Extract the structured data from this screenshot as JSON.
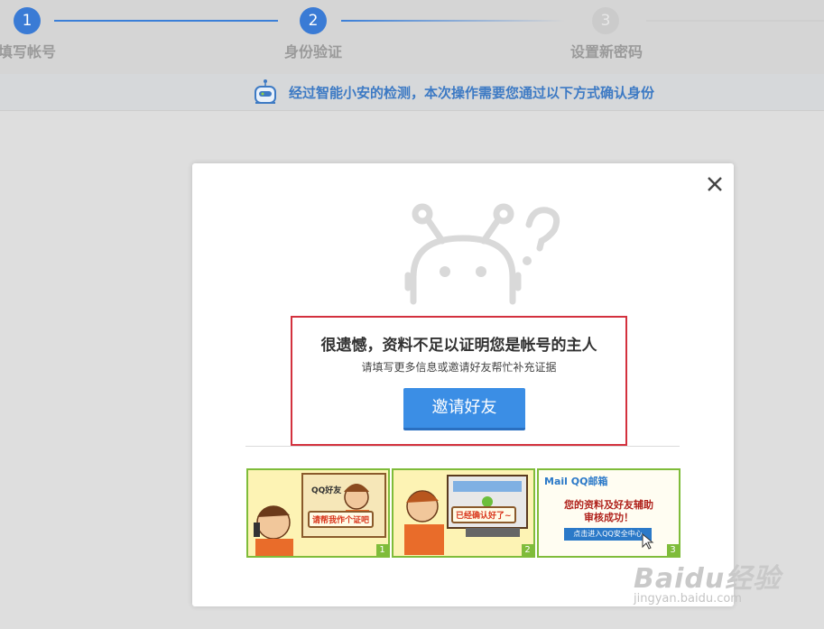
{
  "steps": [
    {
      "number": "1",
      "label": "填写帐号"
    },
    {
      "number": "2",
      "label": "身份验证"
    },
    {
      "number": "3",
      "label": "设置新密码"
    }
  ],
  "notice": {
    "text": "经过智能小安的检测，本次操作需要您通过以下方式确认身份",
    "icon": "robot-icon"
  },
  "dialog": {
    "close_icon": "close-icon",
    "illustration": "confused-robot-icon",
    "title": "很遗憾，资料不足以证明您是帐号的主人",
    "subtitle": "请填写更多信息或邀请好友帮忙补充证据",
    "invite_button": "邀请好友",
    "steps_panels": [
      {
        "number": "1",
        "bubble_top": "QQ好友",
        "bubble": "请帮我作个证吧"
      },
      {
        "number": "2",
        "bubble": "已经确认好了~"
      },
      {
        "number": "3",
        "brand": "Mail QQ邮箱",
        "message_line1": "您的资料及好友辅助",
        "message_line2": "审核成功！",
        "button": "点击进入QQ安全中心"
      }
    ]
  },
  "watermark": {
    "main": "Baidu经验",
    "sub": "jingyan.baidu.com"
  },
  "colors": {
    "accent": "#3a7bd5",
    "button": "#3b8ee5",
    "highlight_border": "#d3313e",
    "panel_border": "#7fbc3a"
  }
}
